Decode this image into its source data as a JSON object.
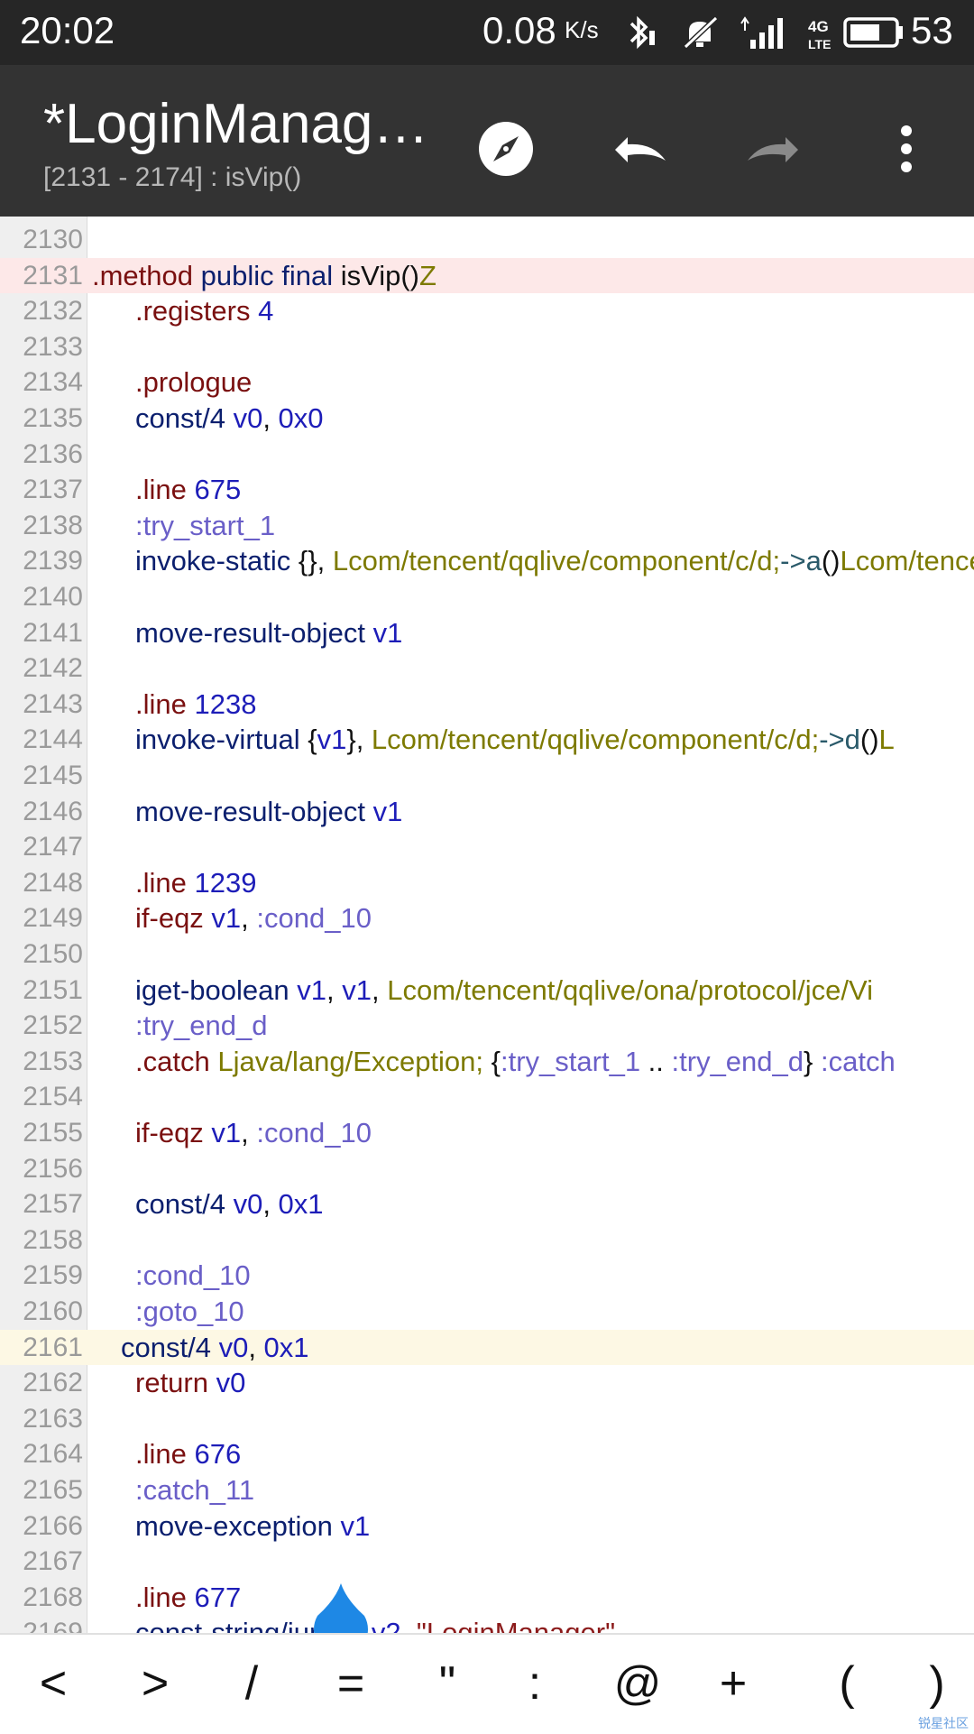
{
  "status_bar": {
    "time": "20:02",
    "net_speed": "0.08",
    "net_speed_unit": "K/s",
    "battery_level": "53",
    "icons": [
      "bluetooth-icon",
      "mute-icon",
      "signal-icon",
      "4g-lte-icon",
      "battery-icon"
    ]
  },
  "app_bar": {
    "title": "*LoginManag…",
    "subtitle": "[2131 - 2174] : isVip()",
    "actions": [
      "compass-icon",
      "undo-icon",
      "redo-icon",
      "more-icon"
    ]
  },
  "editor": {
    "lines": [
      {
        "n": "2130",
        "hl": "",
        "t": []
      },
      {
        "n": "2131",
        "hl": "red",
        "t": [
          [
            ".method",
            "dir"
          ],
          [
            " public",
            "kw"
          ],
          [
            " final",
            "kw"
          ],
          [
            " isVip()",
            "plain"
          ],
          [
            "Z",
            "cls"
          ]
        ],
        "indent": 0
      },
      {
        "n": "2132",
        "hl": "",
        "t": [
          [
            ".registers",
            "dir"
          ],
          [
            " 4",
            "num"
          ]
        ]
      },
      {
        "n": "2133",
        "hl": "",
        "t": []
      },
      {
        "n": "2134",
        "hl": "",
        "t": [
          [
            ".prologue",
            "dir"
          ]
        ]
      },
      {
        "n": "2135",
        "hl": "",
        "t": [
          [
            "const/4",
            "kw"
          ],
          [
            " v0",
            "num"
          ],
          [
            ",",
            "plain"
          ],
          [
            " 0x0",
            "num"
          ]
        ]
      },
      {
        "n": "2136",
        "hl": "",
        "t": []
      },
      {
        "n": "2137",
        "hl": "",
        "t": [
          [
            ".line",
            "dir"
          ],
          [
            " 675",
            "num"
          ]
        ]
      },
      {
        "n": "2138",
        "hl": "",
        "t": [
          [
            ":try_start_1",
            "lbl"
          ]
        ]
      },
      {
        "n": "2139",
        "hl": "",
        "t": [
          [
            "invoke-static",
            "kw"
          ],
          [
            " {},",
            "plain"
          ],
          [
            " Lcom/tencent/qqlive/component/c/d;",
            "cls"
          ],
          [
            "->a",
            "arrow"
          ],
          [
            "()",
            "plain"
          ],
          [
            "Lcom/tencent/qqlive/component",
            "cls"
          ]
        ]
      },
      {
        "n": "2140",
        "hl": "",
        "t": []
      },
      {
        "n": "2141",
        "hl": "",
        "t": [
          [
            "move-result-object",
            "kw"
          ],
          [
            " v1",
            "num"
          ]
        ]
      },
      {
        "n": "2142",
        "hl": "",
        "t": []
      },
      {
        "n": "2143",
        "hl": "",
        "t": [
          [
            ".line",
            "dir"
          ],
          [
            " 1238",
            "num"
          ]
        ]
      },
      {
        "n": "2144",
        "hl": "",
        "t": [
          [
            "invoke-virtual",
            "kw"
          ],
          [
            " {",
            "plain"
          ],
          [
            "v1",
            "num"
          ],
          [
            "},",
            "plain"
          ],
          [
            " Lcom/tencent/qqlive/component/c/d;",
            "cls"
          ],
          [
            "->d",
            "arrow"
          ],
          [
            "()",
            "plain"
          ],
          [
            "L",
            "cls"
          ]
        ]
      },
      {
        "n": "2145",
        "hl": "",
        "t": []
      },
      {
        "n": "2146",
        "hl": "",
        "t": [
          [
            "move-result-object",
            "kw"
          ],
          [
            " v1",
            "num"
          ]
        ]
      },
      {
        "n": "2147",
        "hl": "",
        "t": []
      },
      {
        "n": "2148",
        "hl": "",
        "t": [
          [
            ".line",
            "dir"
          ],
          [
            " 1239",
            "num"
          ]
        ]
      },
      {
        "n": "2149",
        "hl": "",
        "t": [
          [
            "if-eqz",
            "dir"
          ],
          [
            " v1",
            "num"
          ],
          [
            ",",
            "plain"
          ],
          [
            " :cond_10",
            "lbl"
          ]
        ]
      },
      {
        "n": "2150",
        "hl": "",
        "t": []
      },
      {
        "n": "2151",
        "hl": "",
        "t": [
          [
            "iget-boolean",
            "kw"
          ],
          [
            " v1",
            "num"
          ],
          [
            ",",
            "plain"
          ],
          [
            " v1",
            "num"
          ],
          [
            ",",
            "plain"
          ],
          [
            " Lcom/tencent/qqlive/ona/protocol/jce/Vi",
            "cls"
          ]
        ]
      },
      {
        "n": "2152",
        "hl": "",
        "t": [
          [
            ":try_end_d",
            "lbl"
          ]
        ]
      },
      {
        "n": "2153",
        "hl": "",
        "t": [
          [
            ".catch",
            "dir"
          ],
          [
            " Ljava/lang/Exception;",
            "cls"
          ],
          [
            " {",
            "plain"
          ],
          [
            ":try_start_1",
            "lbl"
          ],
          [
            " ..",
            "plain"
          ],
          [
            " :try_end_d",
            "lbl"
          ],
          [
            "}",
            "plain"
          ],
          [
            " :catch",
            "lbl"
          ]
        ]
      },
      {
        "n": "2154",
        "hl": "",
        "t": []
      },
      {
        "n": "2155",
        "hl": "",
        "t": [
          [
            "if-eqz",
            "dir"
          ],
          [
            " v1",
            "num"
          ],
          [
            ",",
            "plain"
          ],
          [
            " :cond_10",
            "lbl"
          ]
        ]
      },
      {
        "n": "2156",
        "hl": "",
        "t": []
      },
      {
        "n": "2157",
        "hl": "",
        "t": [
          [
            "const/4",
            "kw"
          ],
          [
            " v0",
            "num"
          ],
          [
            ",",
            "plain"
          ],
          [
            " 0x1",
            "num"
          ]
        ]
      },
      {
        "n": "2158",
        "hl": "",
        "t": []
      },
      {
        "n": "2159",
        "hl": "",
        "t": [
          [
            ":cond_10",
            "lbl"
          ]
        ]
      },
      {
        "n": "2160",
        "hl": "",
        "t": [
          [
            ":goto_10",
            "lbl"
          ]
        ]
      },
      {
        "n": "2161",
        "hl": "yellow",
        "t": [
          [
            "const/4",
            "kw"
          ],
          [
            " v0",
            "num"
          ],
          [
            ",",
            "plain"
          ],
          [
            " 0x1",
            "num"
          ]
        ],
        "indent": 1
      },
      {
        "n": "2162",
        "hl": "",
        "t": [
          [
            "return",
            "dir"
          ],
          [
            " v0",
            "num"
          ]
        ]
      },
      {
        "n": "2163",
        "hl": "",
        "t": []
      },
      {
        "n": "2164",
        "hl": "",
        "t": [
          [
            ".line",
            "dir"
          ],
          [
            " 676",
            "num"
          ]
        ]
      },
      {
        "n": "2165",
        "hl": "",
        "t": [
          [
            ":catch_11",
            "lbl"
          ]
        ]
      },
      {
        "n": "2166",
        "hl": "",
        "t": [
          [
            "move-exception",
            "kw"
          ],
          [
            " v1",
            "num"
          ]
        ]
      },
      {
        "n": "2167",
        "hl": "",
        "t": []
      },
      {
        "n": "2168",
        "hl": "",
        "t": [
          [
            ".line",
            "dir"
          ],
          [
            " 677",
            "num"
          ]
        ]
      },
      {
        "n": "2169",
        "hl": "",
        "t": [
          [
            "const-string/jumbo",
            "kw"
          ],
          [
            " v2",
            "num"
          ],
          [
            ",",
            "plain"
          ],
          [
            " \"LoginManager\"",
            "str"
          ]
        ]
      }
    ]
  },
  "symbol_bar": {
    "keys": [
      "<",
      ">",
      "/",
      "=",
      "\"",
      ":",
      "@",
      "+",
      "(",
      ")"
    ]
  },
  "watermark": "锐星社区"
}
